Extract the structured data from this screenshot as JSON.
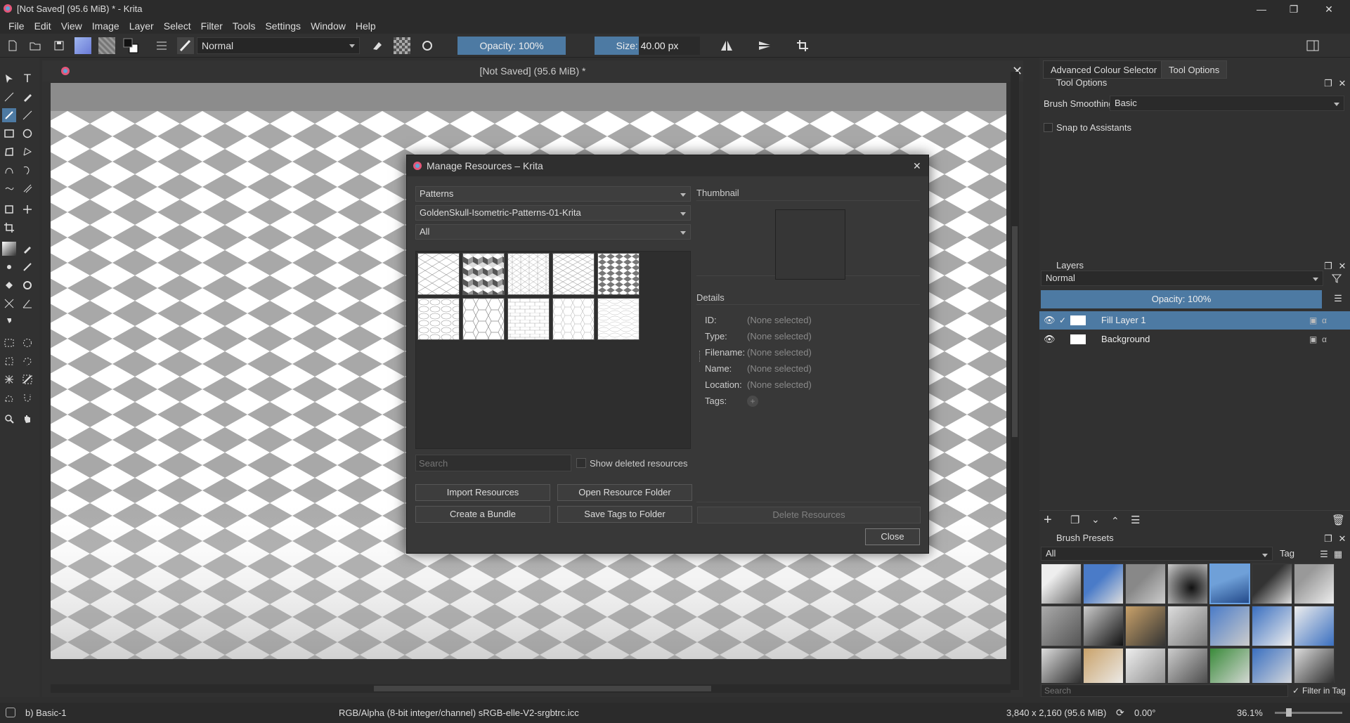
{
  "window": {
    "title": "[Not Saved]  (95.6 MiB) * - Krita"
  },
  "menu": [
    "File",
    "Edit",
    "View",
    "Image",
    "Layer",
    "Select",
    "Filter",
    "Tools",
    "Settings",
    "Window",
    "Help"
  ],
  "toolbar": {
    "blend_mode": "Normal",
    "opacity": "Opacity: 100%",
    "opacity_value": 1.0,
    "size": "Size: 40.00 px"
  },
  "document": {
    "title": "[Not Saved]  (95.6 MiB) *"
  },
  "dialog": {
    "title": "Manage Resources – Krita",
    "resource_type": "Patterns",
    "storage": "GoldenSkull-Isometric-Patterns-01-Krita",
    "tag_filter": "All",
    "search_placeholder": "Search",
    "show_deleted": "Show deleted resources",
    "thumbnail_label": "Thumbnail",
    "details_label": "Details",
    "details": [
      {
        "label": "ID:",
        "value": "(None selected)"
      },
      {
        "label": "Type:",
        "value": "(None selected)"
      },
      {
        "label": "Filename:",
        "value": "(None selected)"
      },
      {
        "label": "Name:",
        "value": "(None selected)"
      },
      {
        "label": "Location:",
        "value": "(None selected)"
      }
    ],
    "tags_label": "Tags:",
    "buttons": {
      "import": "Import Resources",
      "open_folder": "Open Resource Folder",
      "create_bundle": "Create a Bundle",
      "save_tags": "Save Tags to Folder",
      "delete": "Delete Resources",
      "close": "Close"
    }
  },
  "dock": {
    "tabs": [
      "Advanced Colour Selector",
      "Tool Options"
    ],
    "tool_options": {
      "title": "Tool Options",
      "smoothing_label": "Brush Smoothing:",
      "smoothing_value": "Basic",
      "snap": "Snap to Assistants"
    },
    "layers": {
      "title": "Layers",
      "blend": "Normal",
      "opacity": "Opacity:  100%",
      "items": [
        "Fill Layer 1",
        "Background"
      ]
    },
    "brush_presets": {
      "title": "Brush Presets",
      "filter": "All",
      "tag_label": "Tag",
      "search_placeholder": "Search",
      "filter_in_tag": "Filter in Tag"
    }
  },
  "status": {
    "preset": "b) Basic-1",
    "color_space": "RGB/Alpha (8-bit integer/channel)  sRGB-elle-V2-srgbtrc.icc",
    "dimensions": "3,840 x 2,160 (95.6 MiB)",
    "rotation": "0.00°",
    "zoom": "36.1%"
  },
  "colors": {
    "accent": "#4d7aa3",
    "panel": "#313131",
    "dialog": "#383838"
  }
}
